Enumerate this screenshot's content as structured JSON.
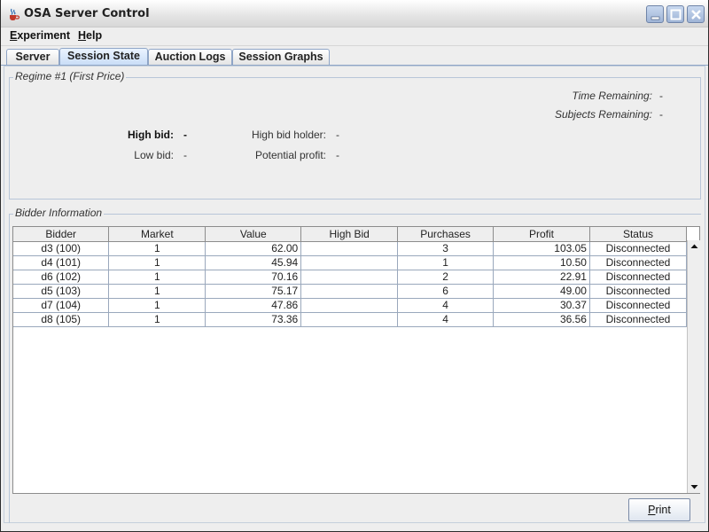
{
  "window": {
    "title": "OSA Server Control",
    "icon": "java-cup-icon"
  },
  "menu": [
    {
      "label": "Experiment",
      "mnemonic": "E"
    },
    {
      "label": "Help",
      "mnemonic": "H"
    }
  ],
  "tabs": [
    {
      "label": "Server",
      "active": false
    },
    {
      "label": "Session State",
      "active": true
    },
    {
      "label": "Auction Logs",
      "active": false
    },
    {
      "label": "Session Graphs",
      "active": false
    }
  ],
  "regime": {
    "title": "Regime #1 (First Price)",
    "time_remaining_label": "Time Remaining:",
    "time_remaining_value": "-",
    "subjects_remaining_label": "Subjects Remaining:",
    "subjects_remaining_value": "-",
    "high_bid_label": "High bid:",
    "high_bid_value": "-",
    "low_bid_label": "Low bid:",
    "low_bid_value": "-",
    "high_bid_holder_label": "High bid holder:",
    "high_bid_holder_value": "-",
    "potential_profit_label": "Potential profit:",
    "potential_profit_value": "-"
  },
  "bidders": {
    "title": "Bidder Information",
    "columns": [
      "Bidder",
      "Market",
      "Value",
      "High Bid",
      "Purchases",
      "Profit",
      "Status"
    ],
    "rows": [
      [
        "d3 (100)",
        "1",
        "62.00",
        "",
        "3",
        "103.05",
        "Disconnected"
      ],
      [
        "d4 (101)",
        "1",
        "45.94",
        "",
        "1",
        "10.50",
        "Disconnected"
      ],
      [
        "d6 (102)",
        "1",
        "70.16",
        "",
        "2",
        "22.91",
        "Disconnected"
      ],
      [
        "d5 (103)",
        "1",
        "75.17",
        "",
        "6",
        "49.00",
        "Disconnected"
      ],
      [
        "d7 (104)",
        "1",
        "47.86",
        "",
        "4",
        "30.37",
        "Disconnected"
      ],
      [
        "d8 (105)",
        "1",
        "73.36",
        "",
        "4",
        "36.56",
        "Disconnected"
      ]
    ]
  },
  "print_button": {
    "label": "Print",
    "mnemonic": "P"
  },
  "colors": {
    "accent": "#c6dbf6",
    "border": "#8fa5c6"
  }
}
